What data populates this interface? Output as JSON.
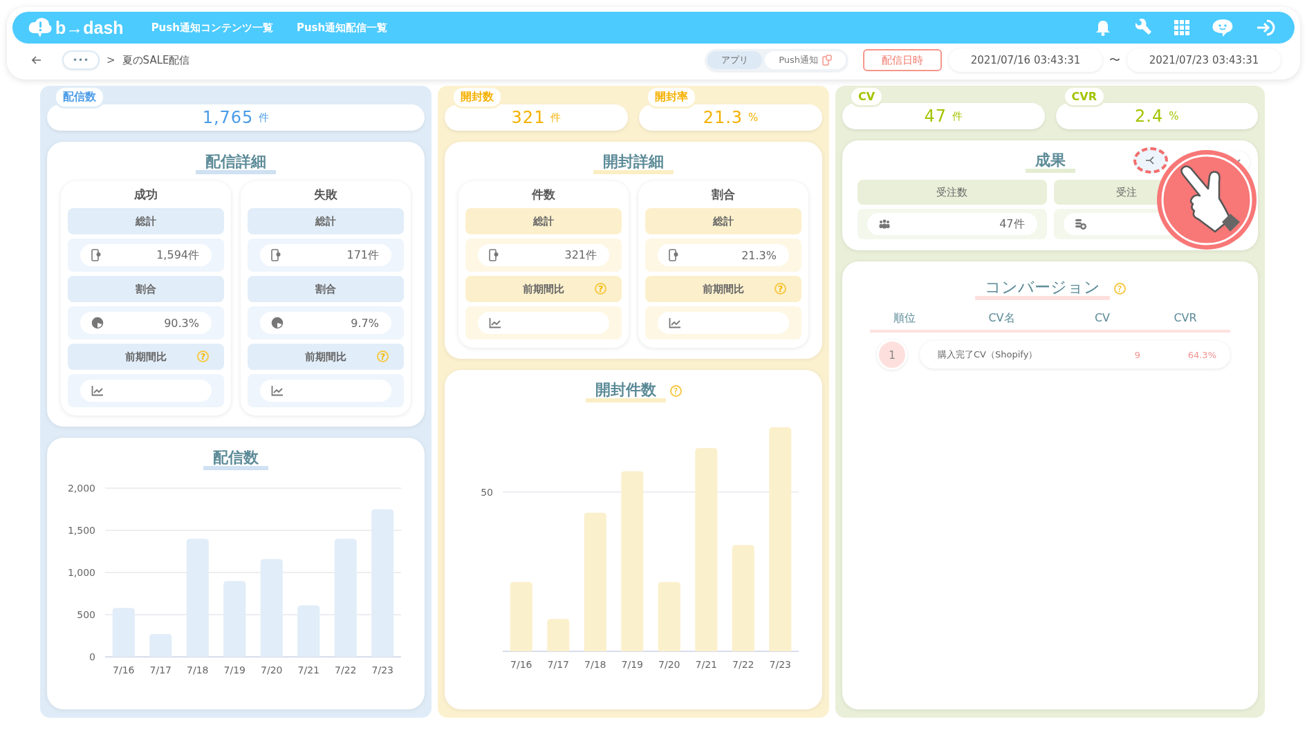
{
  "header": {
    "logo": "b→dash",
    "nav": [
      "Push通知コンテンツ一覧",
      "Push通知配信一覧"
    ]
  },
  "breadcrumb": {
    "more": "•••",
    "separator": ">",
    "current": "夏のSALE配信"
  },
  "filters": {
    "toggle": [
      {
        "label": "アプリ",
        "selected": true
      },
      {
        "label": "Push通知",
        "selected": false
      }
    ],
    "date_button": "配信日時",
    "start": "2021/07/16 03:43:31",
    "tilde": "〜",
    "end": "2021/07/23 03:43:31"
  },
  "columns": [
    {
      "kpis": [
        {
          "label": "配信数",
          "value": "1,765",
          "unit": "件"
        }
      ],
      "detail": {
        "title": "配信詳細",
        "groups": [
          {
            "title": "成功",
            "rows": [
              {
                "kind": "header",
                "label": "総計"
              },
              {
                "kind": "count",
                "value": "1,594件"
              },
              {
                "kind": "header",
                "label": "割合"
              },
              {
                "kind": "ratio",
                "value": "90.3%"
              },
              {
                "kind": "header",
                "label": "前期間比",
                "help": "?"
              },
              {
                "kind": "trend"
              }
            ]
          },
          {
            "title": "失敗",
            "rows": [
              {
                "kind": "header",
                "label": "総計"
              },
              {
                "kind": "count",
                "value": "171件"
              },
              {
                "kind": "header",
                "label": "割合"
              },
              {
                "kind": "ratio",
                "value": "9.7%"
              },
              {
                "kind": "header",
                "label": "前期間比",
                "help": "?"
              },
              {
                "kind": "trend"
              }
            ]
          }
        ]
      },
      "chart": {
        "chart_data": {
          "type": "bar",
          "title": "配信数",
          "categories": [
            "7/16",
            "7/17",
            "7/18",
            "7/19",
            "7/20",
            "7/21",
            "7/22",
            "7/23"
          ],
          "values": [
            580,
            270,
            1400,
            900,
            1160,
            610,
            1400,
            1750
          ],
          "ylim": [
            0,
            2000
          ],
          "grid": true,
          "yticks": [
            {
              "value": 0,
              "label": "0"
            },
            {
              "value": 500,
              "label": "500"
            },
            {
              "value": 1000,
              "label": "1,000"
            },
            {
              "value": 1500,
              "label": "1,500"
            },
            {
              "value": 2000,
              "label": "2,000"
            }
          ]
        }
      }
    },
    {
      "kpis": [
        {
          "label": "開封数",
          "value": "321",
          "unit": "件"
        },
        {
          "label": "開封率",
          "value": "21.3",
          "unit": "%"
        }
      ],
      "detail": {
        "title": "開封詳細",
        "groups": [
          {
            "title": "件数",
            "rows": [
              {
                "kind": "header",
                "label": "総計"
              },
              {
                "kind": "count",
                "value": "321件"
              },
              {
                "kind": "header",
                "label": "前期間比",
                "help": "?"
              },
              {
                "kind": "trend"
              }
            ]
          },
          {
            "title": "割合",
            "rows": [
              {
                "kind": "header",
                "label": "総計"
              },
              {
                "kind": "count",
                "value": "21.3%"
              },
              {
                "kind": "header",
                "label": "前期間比",
                "help": "?"
              },
              {
                "kind": "trend"
              }
            ]
          }
        ]
      },
      "chart": {
        "help": "?",
        "title": "開封件数",
        "tick": "50",
        "categories": [
          "7/16",
          "7/17",
          "7/18",
          "7/19",
          "7/20",
          "7/21",
          "7/22",
          "7/23"
        ]
      }
    },
    {
      "kpis": [
        {
          "label": "CV",
          "value": "47",
          "unit": "件"
        },
        {
          "label": "CVR",
          "value": "2.4",
          "unit": "%"
        }
      ],
      "result": {
        "title": "成果",
        "tiles": [
          {
            "label": "受注数",
            "value": "47件"
          },
          {
            "label": "受注"
          }
        ]
      },
      "conversion": {
        "title": "コンバージョン",
        "help": "?",
        "columns": [
          "順位",
          "CV名",
          "CV",
          "CVR"
        ],
        "rows": [
          {
            "rank": "1",
            "name": "購入完了CV（Shopify）",
            "cv": "9",
            "cvr": "64.3%"
          }
        ]
      }
    }
  ]
}
